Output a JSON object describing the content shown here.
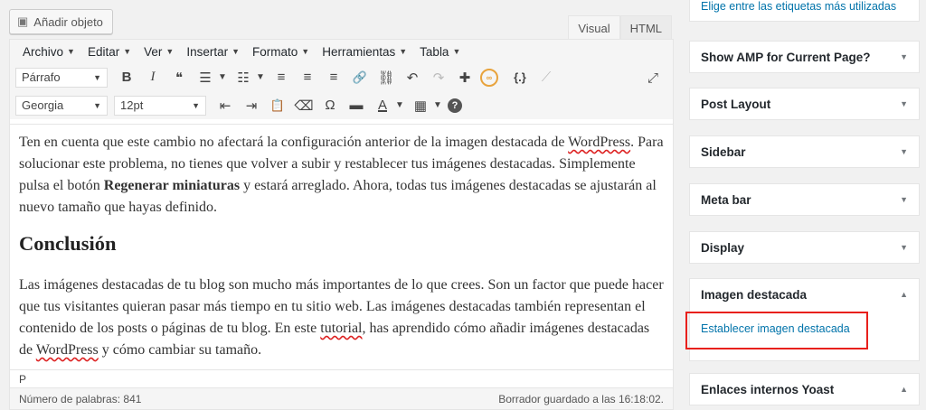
{
  "media_button": {
    "label": "Añadir objeto",
    "icon": "media-icon"
  },
  "tabs": [
    {
      "label": "Visual",
      "active": true
    },
    {
      "label": "HTML",
      "active": false
    }
  ],
  "menubar": [
    "Archivo",
    "Editar",
    "Ver",
    "Insertar",
    "Formato",
    "Herramientas",
    "Tabla"
  ],
  "toolbar1": {
    "format_select": "Párrafo",
    "icons": [
      "bold-icon",
      "italic-icon",
      "blockquote-icon",
      "bullet-list-icon",
      "numbered-list-icon",
      "align-left-icon",
      "align-center-icon",
      "align-right-icon",
      "link-icon",
      "unlink-icon",
      "undo-icon",
      "redo-icon",
      "puzzle-icon",
      "orange-circle-icon",
      "code-brackets-icon",
      "disabled-code-icon",
      "fullscreen-icon"
    ],
    "glyphs": {
      "bold": "B",
      "italic": "I",
      "quote": "❝",
      "ul": "☰",
      "ol": "☷",
      "align_left": "≡",
      "align_center": "≡",
      "align_right": "≡",
      "link": "🔗",
      "unlink": "⛓",
      "undo": "↶",
      "redo": "↷",
      "puzzle": "✚",
      "orange": "∞",
      "code": "{.}",
      "code_dim": "⟋",
      "fullscreen": "⤢"
    }
  },
  "toolbar2": {
    "font_select": "Georgia",
    "size_select": "12pt",
    "glyphs": {
      "outdent": "⇤",
      "indent": "⇥",
      "paste": "📋",
      "eraser": "⌫",
      "omega": "Ω",
      "wp": "▬",
      "textcolor": "A",
      "table": "▦",
      "help": "?"
    }
  },
  "content": {
    "p1_a": "Ten en cuenta que este cambio no afectará la configuración anterior de la imagen destacada de ",
    "p1_wp": "WordPress",
    "p1_b": ". Para solucionar este problema, no tienes que volver a subir y restablecer tus imágenes destacadas. Simplemente pulsa el botón ",
    "p1_bold": "Regenerar miniaturas",
    "p1_c": " y estará arreglado. Ahora, todas tus imágenes destacadas se ajustarán al nuevo tamaño que hayas definido.",
    "heading": "Conclusión",
    "p2_a": "Las imágenes destacadas de tu blog son mucho más importantes de lo que crees. Son un factor que puede hacer que tus visitantes quieran pasar más tiempo en tu sitio web. Las imágenes destacadas también representan el contenido de los posts o páginas de tu blog. En este ",
    "p2_tut": "tutorial",
    "p2_b": ", has aprendido cómo añadir imágenes destacadas de ",
    "p2_wp": "WordPress",
    "p2_c": " y cómo cambiar su tamaño."
  },
  "path": "P",
  "status": {
    "word_count": "Número de palabras: 841",
    "draft": "Borrador guardado a las 16:18:02."
  },
  "sidebar": {
    "tag_link": "Elige entre las etiquetas más utilizadas",
    "boxes": [
      {
        "label": "Show AMP for Current Page?",
        "arrow": "▼"
      },
      {
        "label": "Post Layout",
        "arrow": "▼"
      },
      {
        "label": "Sidebar",
        "arrow": "▼"
      },
      {
        "label": "Meta bar",
        "arrow": "▼"
      },
      {
        "label": "Display",
        "arrow": "▼"
      },
      {
        "label": "Imagen destacada",
        "arrow": "▲"
      },
      {
        "label": "Enlaces internos Yoast",
        "arrow": "▲"
      }
    ],
    "featured_link": "Establecer imagen destacada"
  },
  "colors": {
    "link": "#0073aa",
    "highlight": "#e8201c"
  }
}
